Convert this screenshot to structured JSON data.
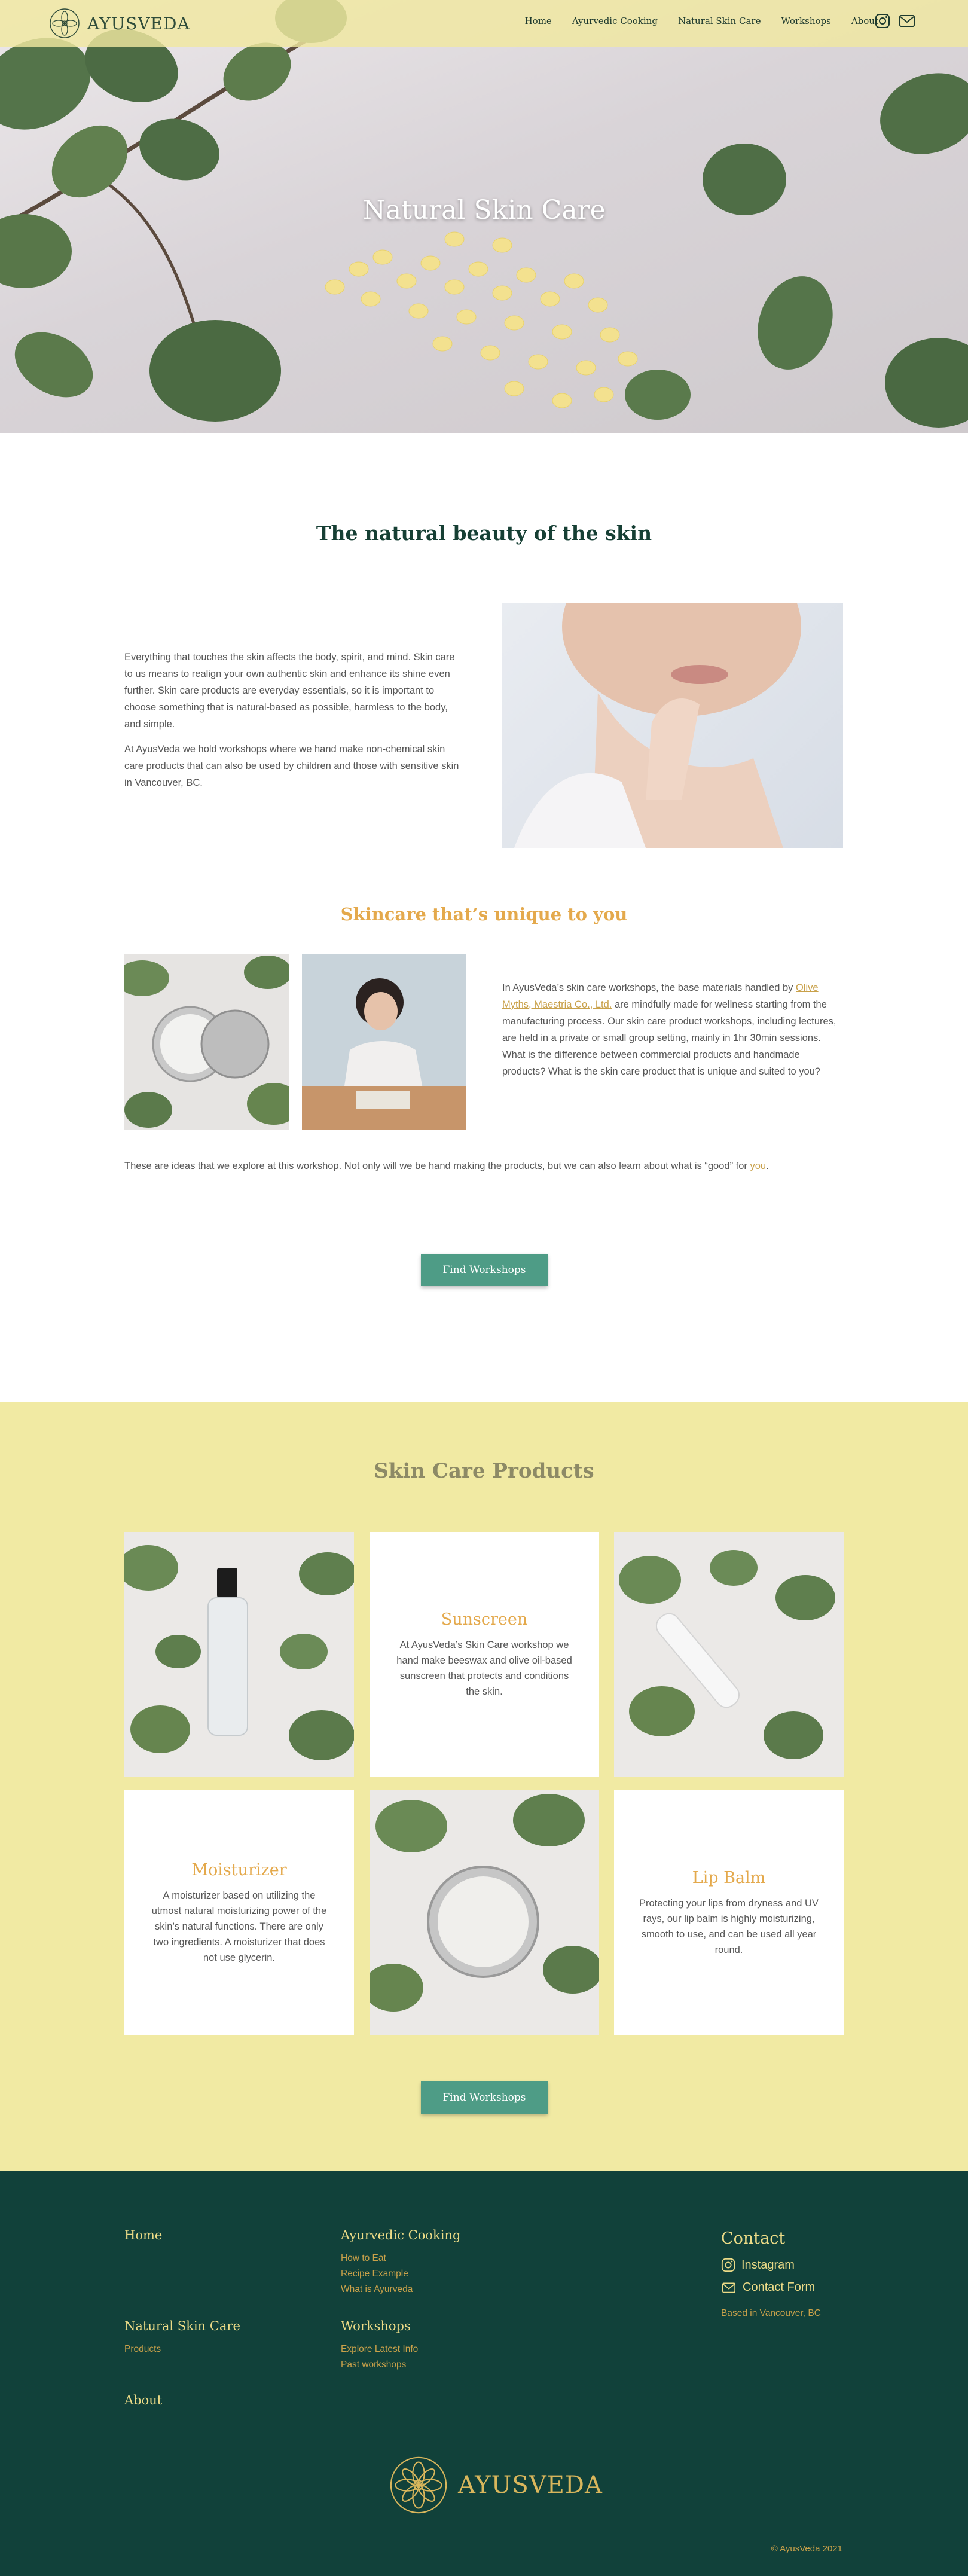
{
  "header": {
    "brand": "AYUSVEDA",
    "nav": [
      "Home",
      "Ayurvedic Cooking",
      "Natural Skin Care",
      "Workshops",
      "About"
    ]
  },
  "hero": {
    "title": "Natural Skin Care"
  },
  "intro": {
    "heading": "The natural beauty of the skin",
    "paragraph1": "Everything that touches the skin affects the body, spirit, and mind. Skin care to us means to realign your own authentic skin and enhance its shine even further. Skin care products are everyday essentials, so it is important to choose something that is natural-based as possible, harmless to the body, and simple.",
    "paragraph2": "At AyusVeda we hold workshops where we hand make non-chemical skin care products that can also be used by children and those with sensitive skin in Vancouver, BC."
  },
  "unique": {
    "heading": "Skincare that’s unique to you",
    "text_before": "In AyusVeda’s skin care workshops, the base materials handled by ",
    "link": "Olive Myths, Maestria Co., Ltd.",
    "text_after": " are mindfully made for wellness starting from the manufacturing process. Our skin care product workshops, including lectures, are held in a private or small group setting, mainly in 1hr 30min sessions. What is the difference between commercial products and handmade products? What is the skin care product that is unique and suited to you?",
    "ideas_before": "These are ideas that we explore at this workshop. Not only will we be hand making the products, but we can also learn about what is “good” for ",
    "ideas_you": "you",
    "ideas_after": "."
  },
  "buttons": {
    "find_workshops": "Find Workshops"
  },
  "products": {
    "heading": "Skin Care Products",
    "sunscreen": {
      "title": "Sunscreen",
      "desc": "At AyusVeda’s Skin Care workshop we hand make beeswax and olive oil-based sunscreen that protects and conditions the skin."
    },
    "moisturizer": {
      "title": "Moisturizer",
      "desc": "A moisturizer based on utilizing the utmost natural moisturizing power of the skin’s natural functions. There are only two ingredients. A moisturizer that does not use glycerin."
    },
    "lipbalm": {
      "title": "Lip Balm",
      "desc": "Protecting your lips from dryness and UV rays, our lip balm is highly moisturizing, smooth to use, and can be used all year round."
    }
  },
  "footer": {
    "home": "Home",
    "cooking": "Ayurvedic Cooking",
    "cooking_links": [
      "How to Eat",
      "Recipe Example",
      "What is Ayurveda"
    ],
    "skincare": "Natural Skin Care",
    "skincare_links": [
      "Products"
    ],
    "workshops": "Workshops",
    "workshops_links": [
      "Explore Latest Info",
      "Past workshops"
    ],
    "about": "About",
    "contact_title": "Contact",
    "instagram": "Instagram",
    "contact_form": "Contact Form",
    "location": "Based in Vancouver, BC",
    "brand": "AYUSVEDA",
    "copyright": "© AyusVeda 2021"
  },
  "colors": {
    "accent_yellow": "#f1eaa3",
    "gold": "#e4a94c",
    "button_green": "#4e9c86",
    "footer_green": "#11413a"
  }
}
